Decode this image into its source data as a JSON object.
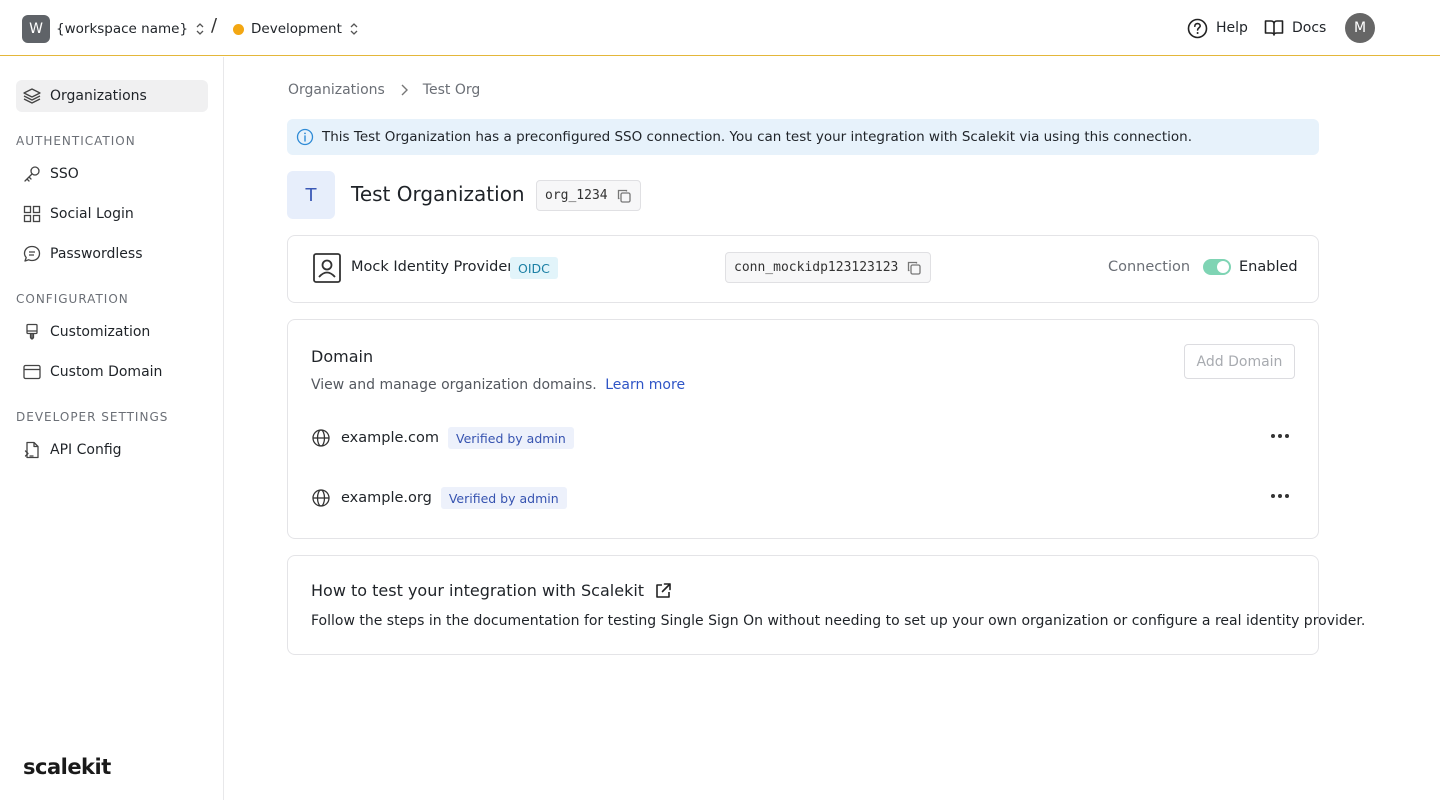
{
  "topbar": {
    "workspace_initial": "W",
    "workspace_name": "{workspace name}",
    "separator": "/",
    "environment": "Development",
    "help_label": "Help",
    "docs_label": "Docs",
    "user_initial": "M",
    "env_color": "#f3a712"
  },
  "sidebar": {
    "organizations": "Organizations",
    "section_auth": "AUTHENTICATION",
    "sso": "SSO",
    "social_login": "Social Login",
    "passwordless": "Passwordless",
    "section_config": "CONFIGURATION",
    "customization": "Customization",
    "custom_domain": "Custom Domain",
    "section_dev": "DEVELOPER SETTINGS",
    "api_config": "API Config",
    "brand": "scalekit"
  },
  "breadcrumb": {
    "root": "Organizations",
    "current": "Test Org"
  },
  "banner": {
    "text": "This Test Organization has a preconfigured SSO connection. You can  test your integration with Scalekit via using this connection."
  },
  "org": {
    "initial": "T",
    "title": "Test Organization",
    "id": "org_1234"
  },
  "connection": {
    "provider": "Mock Identity Provider",
    "protocol": "OIDC",
    "id": "conn_mockidp123123123",
    "label": "Connection",
    "status": "Enabled",
    "enabled": true
  },
  "domain": {
    "heading": "Domain",
    "subtitle": "View and manage organization domains.",
    "learn_more": "Learn more",
    "add_button": "Add Domain",
    "rows": [
      {
        "name": "example.com",
        "badge": "Verified by admin"
      },
      {
        "name": "example.org",
        "badge": "Verified by admin"
      }
    ]
  },
  "howto": {
    "heading": "How to test your integration with Scalekit",
    "description": "Follow the steps in the documentation for testing Single Sign On without needing to set up your own organization or configure a real identity provider."
  }
}
